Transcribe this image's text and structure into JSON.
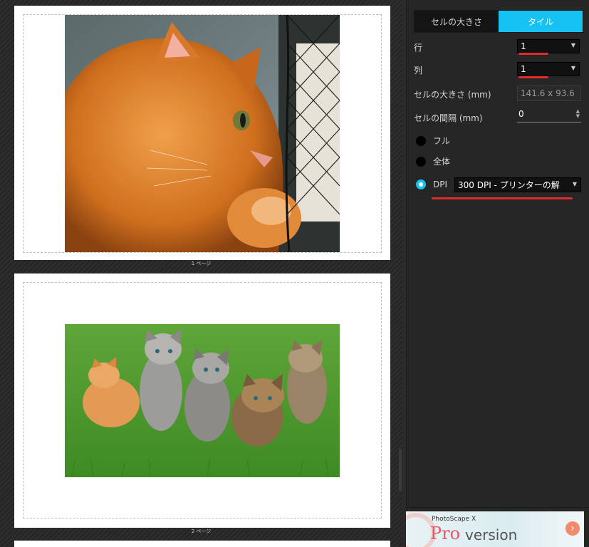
{
  "pages": [
    {
      "label": "1 ページ",
      "photo": "orange-cat-photo"
    },
    {
      "label": "2 ページ",
      "photo": "kittens-photo"
    }
  ],
  "panel": {
    "tabs": [
      {
        "label": "セルの大きさ",
        "active": false
      },
      {
        "label": "タイル",
        "active": true
      }
    ],
    "rows_label": "行",
    "rows_value": "1",
    "cols_label": "列",
    "cols_value": "1",
    "cell_size_label": "セルの大きさ (mm)",
    "cell_size_value": "141.6 x 93.6",
    "cell_gap_label": "セルの間隔 (mm)",
    "cell_gap_value": "0",
    "fit_options": [
      {
        "label": "フル",
        "checked": false
      },
      {
        "label": "全体",
        "checked": false
      },
      {
        "label": "DPI",
        "checked": true
      }
    ],
    "dpi_value": "300 DPI - プリンターの解"
  },
  "banner": {
    "brand": "PhotoScape X",
    "pro": "Pro",
    "version": "version"
  },
  "colors": {
    "accent": "#16c1f3",
    "annotation": "#e12b2b"
  }
}
